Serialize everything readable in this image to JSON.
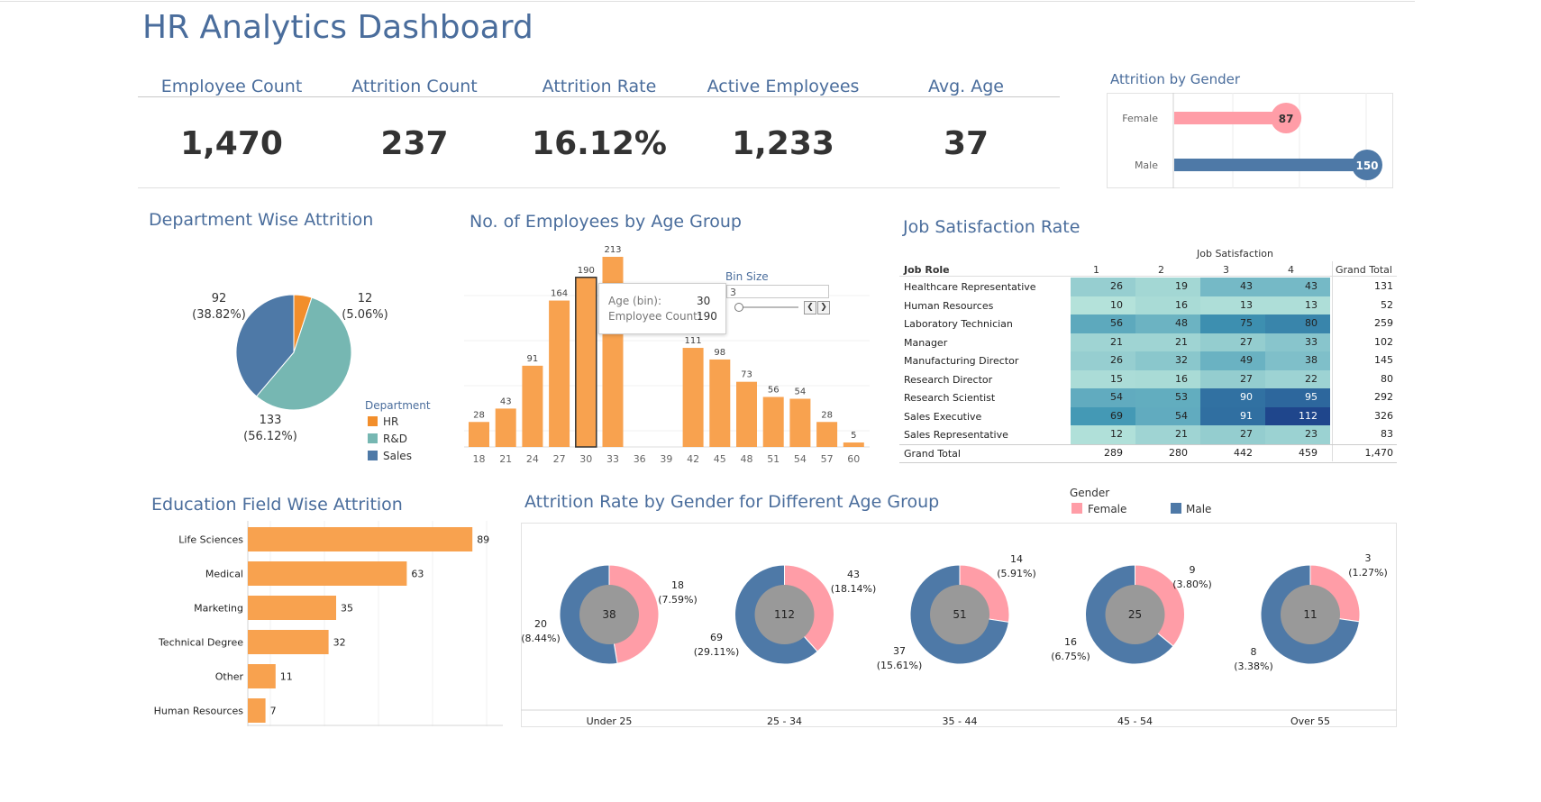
{
  "header": {
    "title": "HR Analytics Dashboard"
  },
  "kpis": [
    {
      "label": "Employee Count",
      "value": "1,470"
    },
    {
      "label": "Attrition Count",
      "value": "237"
    },
    {
      "label": "Attrition Rate",
      "value": "16.12%"
    },
    {
      "label": "Active Employees",
      "value": "1,233"
    },
    {
      "label": "Avg. Age",
      "value": "37"
    }
  ],
  "gender_panel": {
    "title": "Attrition by Gender"
  },
  "dept_panel": {
    "title": "Department Wise Attrition",
    "legend_title": "Department"
  },
  "age_panel": {
    "title": "No. of Employees by Age Group",
    "bin_size_label": "Bin Size",
    "bin_size_value": "3",
    "tooltip": {
      "label1": "Age (bin):",
      "value1": "30",
      "label2": "Employee Count:",
      "value2": "190"
    }
  },
  "jobsat_panel": {
    "title": "Job Satisfaction Rate"
  },
  "edu_panel": {
    "title": "Education Field Wise Attrition"
  },
  "donut_panel": {
    "title": "Attrition Rate by Gender for Different Age Group",
    "legend_title": "Gender"
  },
  "colors": {
    "orange": "#f8a24f",
    "teal": "#76b7b2",
    "blue": "#4e79a7",
    "pink": "#ff9da7",
    "grey": "#999999",
    "title": "#4a6d9c"
  },
  "chart_data": [
    {
      "id": "gender",
      "type": "bar",
      "title": "Attrition by Gender",
      "categories": [
        "Female",
        "Male"
      ],
      "values": [
        87,
        150
      ],
      "colors": [
        "#ff9da7",
        "#4e79a7"
      ]
    },
    {
      "id": "department",
      "type": "pie",
      "title": "Department Wise Attrition",
      "labels": [
        "HR",
        "R&D",
        "Sales"
      ],
      "values": [
        12,
        133,
        92
      ],
      "value_labels": [
        "12",
        "133",
        "92"
      ],
      "pct_labels": [
        "(5.06%)",
        "(56.12%)",
        "(38.82%)"
      ],
      "colors": [
        "#f28e2b",
        "#76b7b2",
        "#4e79a7"
      ]
    },
    {
      "id": "age",
      "type": "bar",
      "title": "No. of Employees by Age Group",
      "categories": [
        "18",
        "21",
        "24",
        "27",
        "30",
        "33",
        "36",
        "39",
        "42",
        "45",
        "48",
        "51",
        "54",
        "57",
        "60"
      ],
      "values": [
        28,
        43,
        91,
        164,
        190,
        213,
        0,
        0,
        111,
        98,
        73,
        56,
        54,
        28,
        5
      ],
      "value_labels": [
        "28",
        "43",
        "91",
        "164",
        "190",
        "213",
        "",
        "",
        "111",
        "98",
        "73",
        "56",
        "54",
        "28",
        "5"
      ],
      "ylim": [
        0,
        213
      ],
      "selected": "30"
    },
    {
      "id": "jobsat",
      "type": "heatmap",
      "title": "Job Satisfaction Rate",
      "column_header": "Job Satisfaction",
      "row_header": "Job Role",
      "columns": [
        "1",
        "2",
        "3",
        "4"
      ],
      "total_label": "Grand Total",
      "rows": [
        {
          "role": "Healthcare Representative",
          "values": [
            26,
            19,
            43,
            43
          ],
          "total": "131"
        },
        {
          "role": "Human Resources",
          "values": [
            10,
            16,
            13,
            13
          ],
          "total": "52"
        },
        {
          "role": "Laboratory Technician",
          "values": [
            56,
            48,
            75,
            80
          ],
          "total": "259"
        },
        {
          "role": "Manager",
          "values": [
            21,
            21,
            27,
            33
          ],
          "total": "102"
        },
        {
          "role": "Manufacturing Director",
          "values": [
            26,
            32,
            49,
            38
          ],
          "total": "145"
        },
        {
          "role": "Research Director",
          "values": [
            15,
            16,
            27,
            22
          ],
          "total": "80"
        },
        {
          "role": "Research Scientist",
          "values": [
            54,
            53,
            90,
            95
          ],
          "total": "292"
        },
        {
          "role": "Sales Executive",
          "values": [
            69,
            54,
            91,
            112
          ],
          "total": "326"
        },
        {
          "role": "Sales Representative",
          "values": [
            12,
            21,
            27,
            23
          ],
          "total": "83"
        }
      ],
      "grand_total_row": {
        "label": "Grand Total",
        "values": [
          "289",
          "280",
          "442",
          "459"
        ],
        "total": "1,470"
      }
    },
    {
      "id": "education",
      "type": "bar",
      "title": "Education Field Wise Attrition",
      "categories": [
        "Life Sciences",
        "Medical",
        "Marketing",
        "Technical Degree",
        "Other",
        "Human Resources"
      ],
      "values": [
        89,
        63,
        35,
        32,
        11,
        7
      ],
      "xlim": [
        0,
        100
      ]
    },
    {
      "id": "gender_age",
      "type": "pie",
      "title": "Attrition Rate by Gender for Different Age Group",
      "legend": [
        "Female",
        "Male"
      ],
      "groups": [
        {
          "label": "Under 25",
          "total": "38",
          "female": 18,
          "female_label": "18",
          "female_pct": "(7.59%)",
          "male": 20,
          "male_label": "20",
          "male_pct": "(8.44%)"
        },
        {
          "label": "25 - 34",
          "total": "112",
          "female": 43,
          "female_label": "43",
          "female_pct": "(18.14%)",
          "male": 69,
          "male_label": "69",
          "male_pct": "(29.11%)"
        },
        {
          "label": "35 - 44",
          "total": "51",
          "female": 14,
          "female_label": "14",
          "female_pct": "(5.91%)",
          "male": 37,
          "male_label": "37",
          "male_pct": "(15.61%)"
        },
        {
          "label": "45 - 54",
          "total": "25",
          "female": 9,
          "female_label": "9",
          "female_pct": "(3.80%)",
          "male": 16,
          "male_label": "16",
          "male_pct": "(6.75%)"
        },
        {
          "label": "Over 55",
          "total": "11",
          "female": 3,
          "female_label": "3",
          "female_pct": "(1.27%)",
          "male": 8,
          "male_label": "8",
          "male_pct": "(3.38%)"
        }
      ]
    }
  ]
}
